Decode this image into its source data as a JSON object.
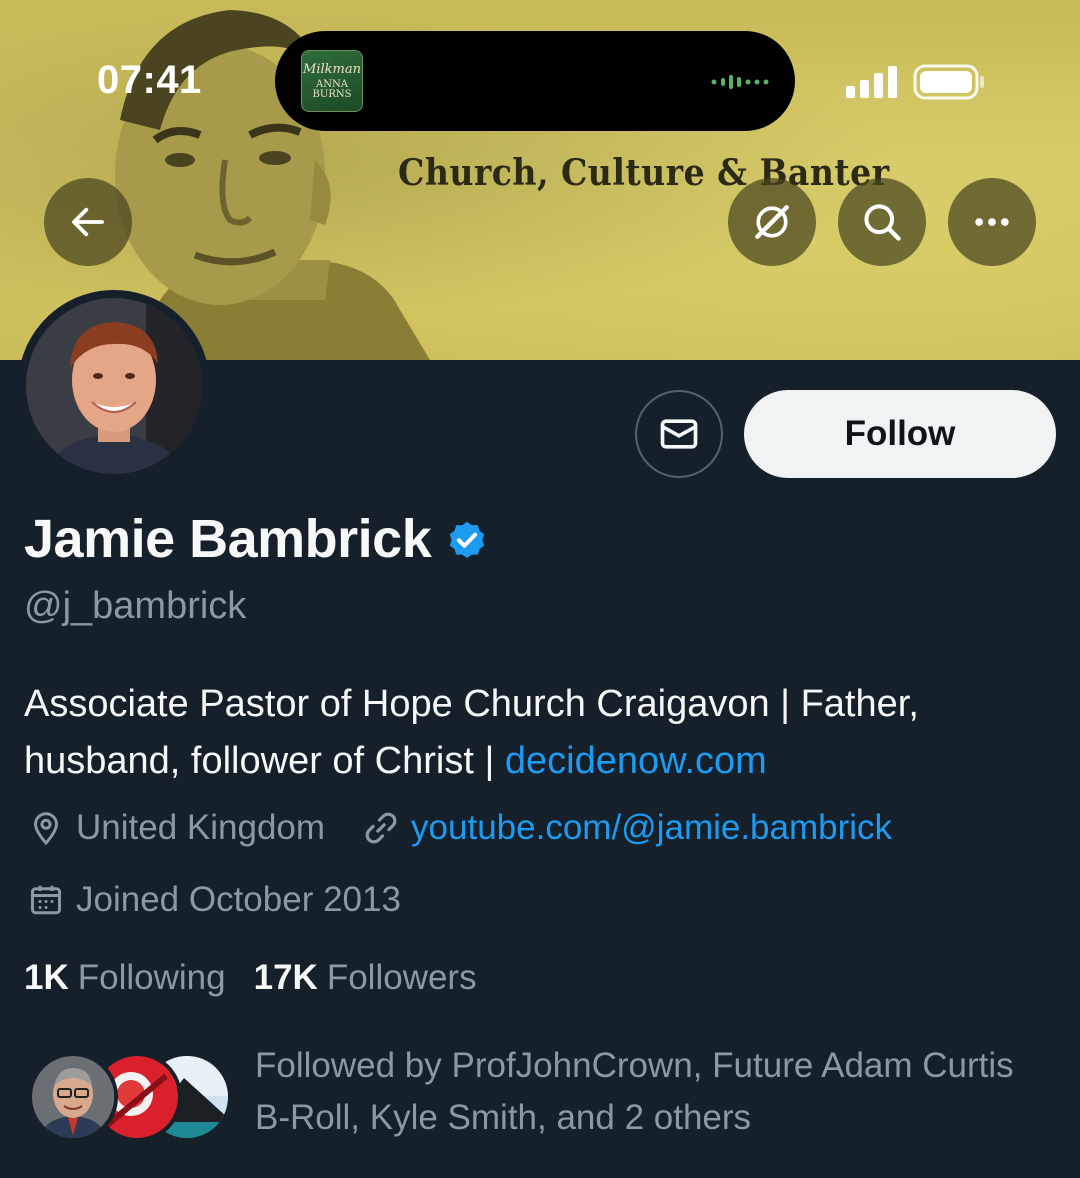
{
  "status_bar": {
    "time": "07:41",
    "now_playing_art": {
      "line1": "Milkman",
      "line2": "ANNA",
      "line3": "BURNS"
    }
  },
  "banner": {
    "text": "Church, Culture & Banter"
  },
  "header_buttons": {
    "back_icon": "arrow-left-icon",
    "grok_icon": "grok-icon",
    "search_icon": "search-icon",
    "more_icon": "more-horizontal-icon"
  },
  "actions": {
    "message_icon": "envelope-icon",
    "follow_label": "Follow"
  },
  "profile": {
    "name": "Jamie Bambrick",
    "handle": "@j_bambrick",
    "verified": true,
    "bio_text": "Associate Pastor of Hope Church Craigavon | Father, husband, follower of Christ | ",
    "bio_link": "decidenow.com",
    "location": "United Kingdom",
    "website": "youtube.com/@jamie.bambrick",
    "joined": "Joined October 2013",
    "following_count": "1K",
    "following_label": "Following",
    "followers_count": "17K",
    "followers_label": "Followers",
    "followed_by": "Followed by ProfJohnCrown, Future Adam Curtis B-Roll, Kyle Smith, and 2 others"
  },
  "colors": {
    "background": "#15202b",
    "accent": "#1d9bf0",
    "muted": "#8b98a5",
    "banner": "#cbbd5a"
  }
}
